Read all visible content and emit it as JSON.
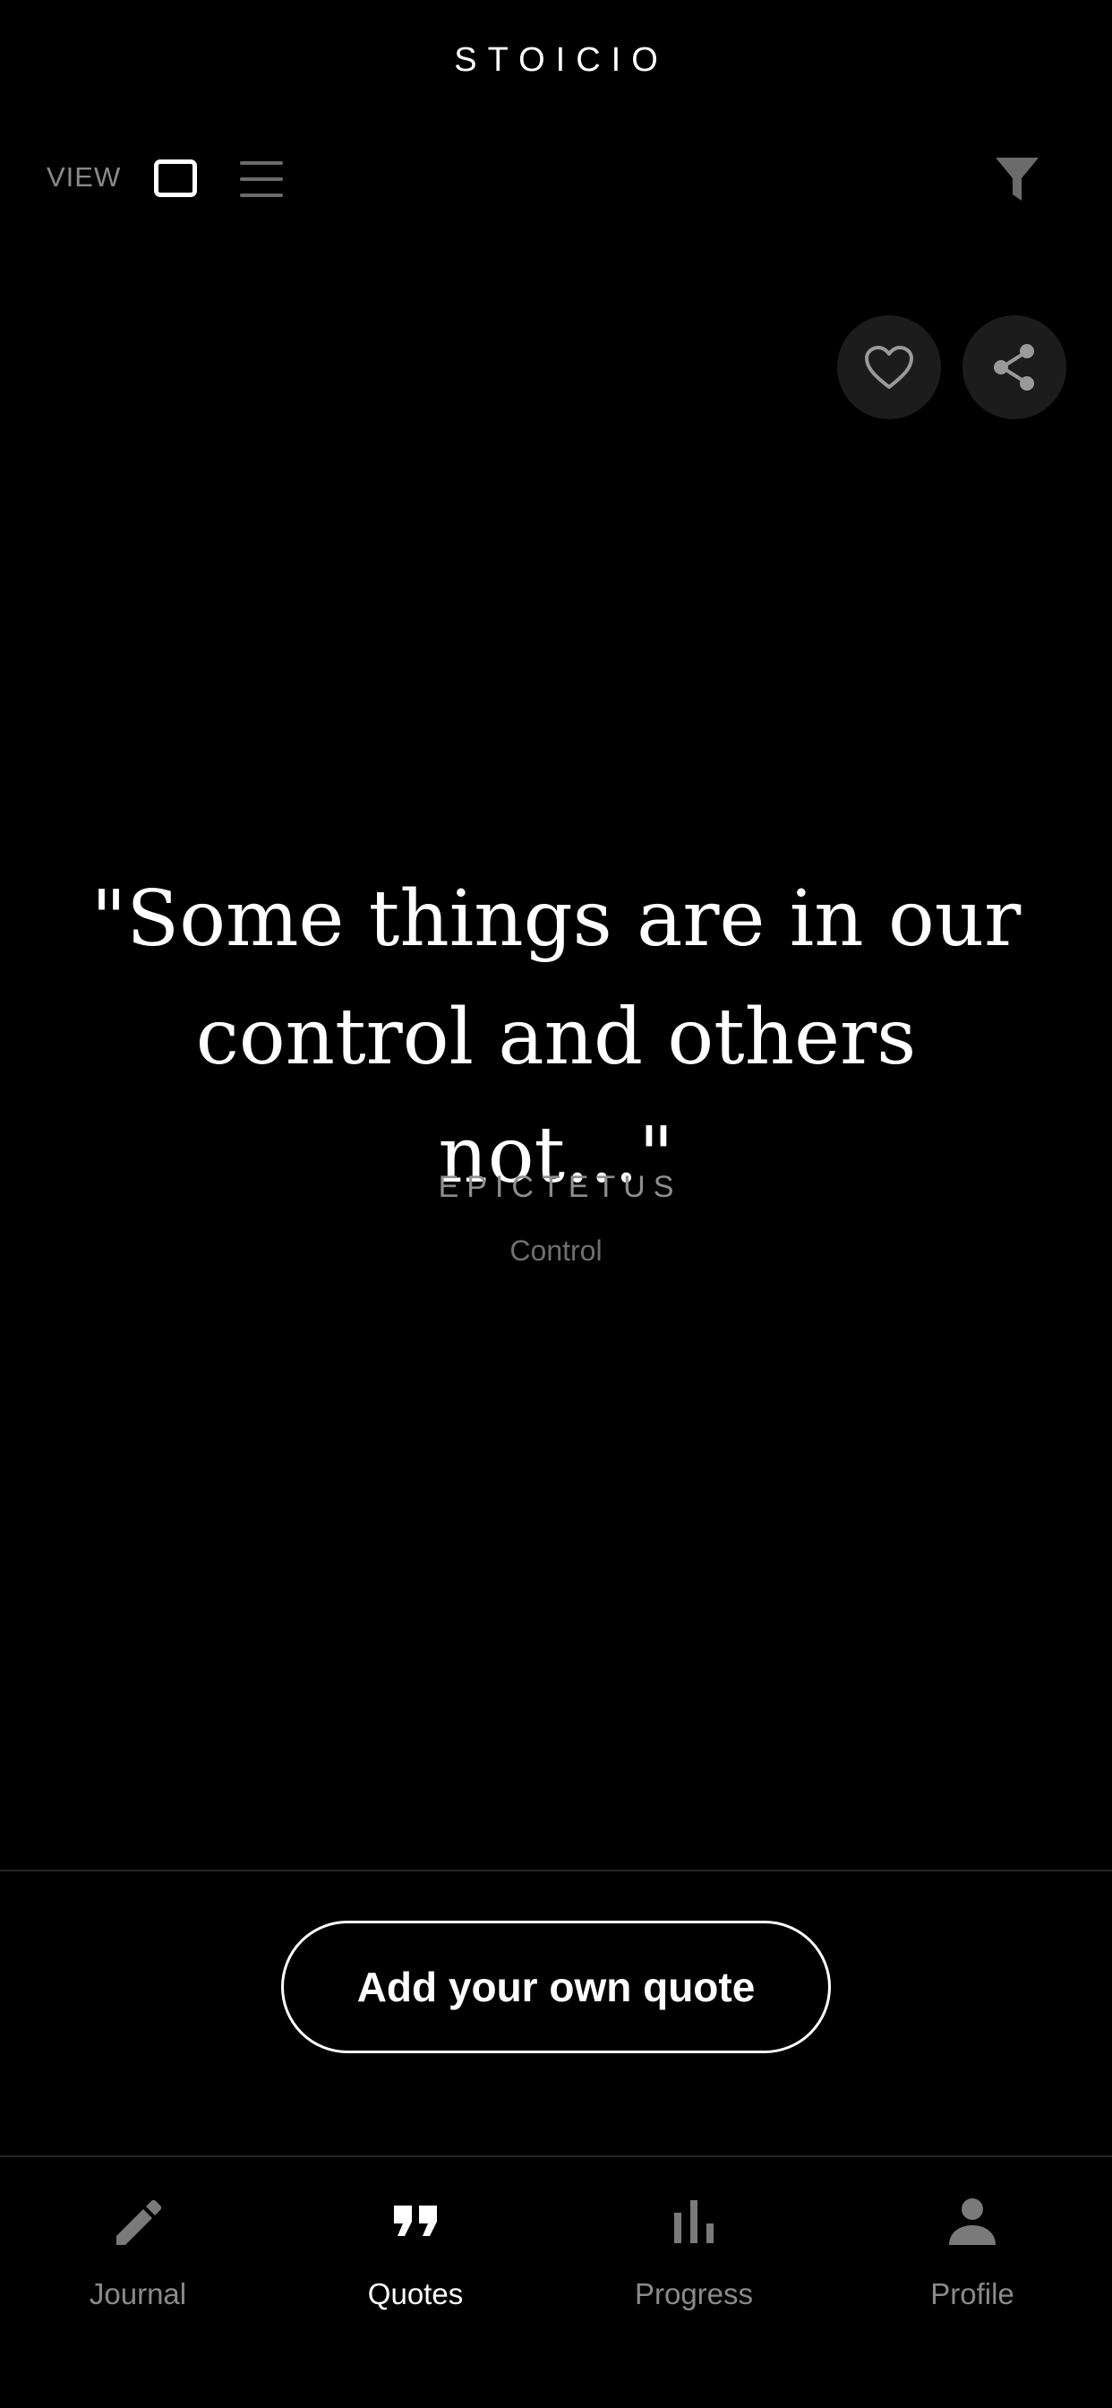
{
  "header": {
    "app_title": "STOICIO",
    "view_label": "VIEW",
    "view_modes": [
      "card",
      "list"
    ],
    "active_view_mode": "card"
  },
  "actions": {
    "favorite_icon": "heart-outline-icon",
    "share_icon": "share-icon",
    "filter_icon": "filter-funnel-icon"
  },
  "quote": {
    "text": "\"Some things are in our control and others not...\"",
    "author": "EPICTETUS",
    "category": "Control"
  },
  "add_quote": {
    "label": "Add your own quote"
  },
  "tabs": [
    {
      "label": "Journal",
      "icon": "pencil-icon",
      "active": false
    },
    {
      "label": "Quotes",
      "icon": "quote-marks-icon",
      "active": true
    },
    {
      "label": "Progress",
      "icon": "bar-chart-icon",
      "active": false
    },
    {
      "label": "Profile",
      "icon": "person-icon",
      "active": false
    }
  ],
  "colors": {
    "background": "#000000",
    "text_primary": "#ffffff",
    "text_secondary": "#8a8a8a",
    "button_bg": "#1c1c1c",
    "inactive_icon": "#6b6b6b"
  }
}
